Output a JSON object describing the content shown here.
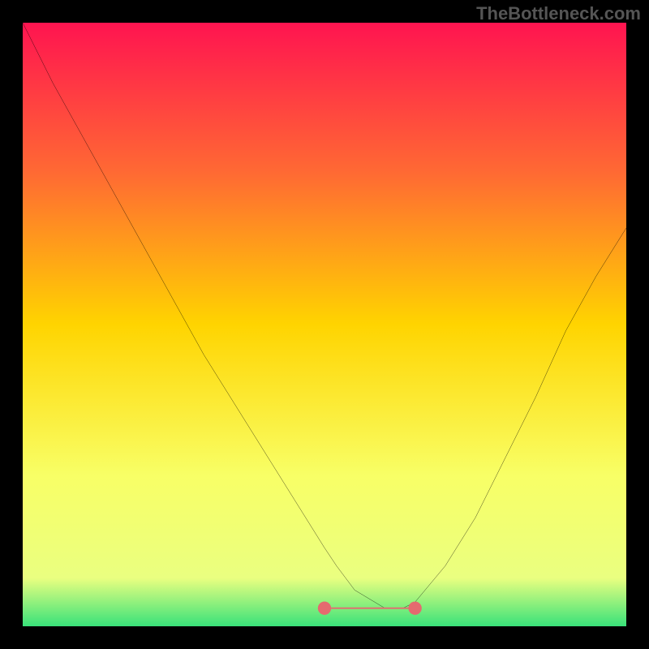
{
  "watermark": "TheBottleneck.com",
  "chart_data": {
    "type": "line",
    "title": "",
    "xlabel": "",
    "ylabel": "",
    "xlim": [
      0,
      100
    ],
    "ylim": [
      0,
      100
    ],
    "background_gradient": {
      "stops": [
        {
          "offset": 0,
          "color": "#ff1450"
        },
        {
          "offset": 25,
          "color": "#ff6a33"
        },
        {
          "offset": 50,
          "color": "#ffd400"
        },
        {
          "offset": 75,
          "color": "#f8ff66"
        },
        {
          "offset": 92,
          "color": "#eaff80"
        },
        {
          "offset": 100,
          "color": "#39e27a"
        }
      ]
    },
    "series": [
      {
        "name": "bottleneck-curve",
        "color": "#000000",
        "x": [
          0,
          5,
          10,
          15,
          20,
          25,
          30,
          35,
          40,
          45,
          50,
          52,
          55,
          60,
          63,
          65,
          70,
          75,
          80,
          85,
          90,
          95,
          100
        ],
        "y": [
          100,
          90,
          81,
          72,
          63,
          54,
          45,
          37,
          29,
          21,
          13,
          10,
          6,
          3,
          3,
          4,
          10,
          18,
          28,
          38,
          49,
          58,
          66
        ]
      }
    ],
    "optimal_band": {
      "name": "flat-optimal-region",
      "color": "#e56a6f",
      "x_start": 50,
      "x_end": 65,
      "y": 3
    }
  }
}
